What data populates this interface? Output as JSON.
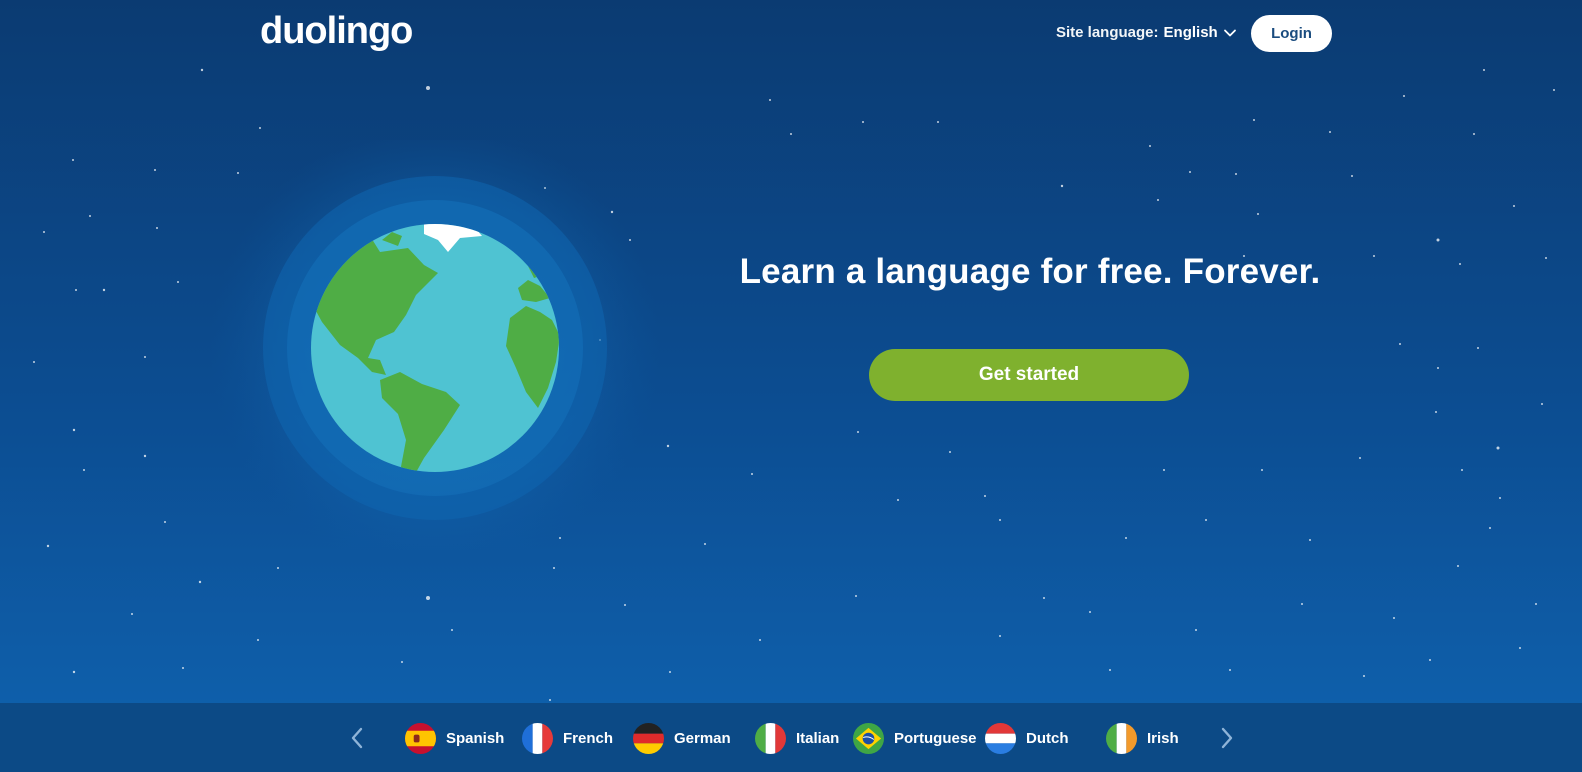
{
  "header": {
    "logo": "duolingo",
    "site_language_label": "Site language:",
    "site_language_value": "English",
    "login_label": "Login"
  },
  "hero": {
    "title": "Learn a language for free. Forever.",
    "cta_label": "Get started"
  },
  "languages": [
    {
      "name": "Spanish",
      "flag": "spain-flag"
    },
    {
      "name": "French",
      "flag": "france-flag"
    },
    {
      "name": "German",
      "flag": "germany-flag"
    },
    {
      "name": "Italian",
      "flag": "italy-flag"
    },
    {
      "name": "Portuguese",
      "flag": "brazil-flag"
    },
    {
      "name": "Dutch",
      "flag": "netherlands-flag"
    },
    {
      "name": "Irish",
      "flag": "ireland-flag"
    }
  ],
  "colors": {
    "background_top": "#0b3b72",
    "background_bottom": "#0f63b0",
    "cta": "#7fb12e",
    "login_text": "#1a4c7f",
    "ocean": "#4fc3d2",
    "land": "#4fad45"
  }
}
